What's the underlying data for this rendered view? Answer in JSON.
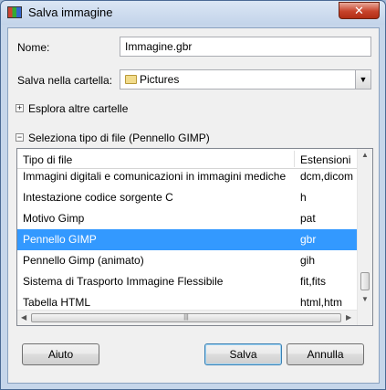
{
  "window": {
    "title": "Salva immagine",
    "close_label": "✕"
  },
  "form": {
    "name_label": "Nome:",
    "name_value": "Immagine.gbr",
    "folder_label": "Salva nella cartella:",
    "folder_value": "Pictures"
  },
  "expanders": {
    "browse_label": "Esplora altre cartelle",
    "browse_state": "+",
    "filetype_label": "Seleziona tipo di file (Pennello GIMP)",
    "filetype_state": "−"
  },
  "filetype_list": {
    "columns": [
      "Tipo di file",
      "Estensioni"
    ],
    "rows": [
      {
        "type": "Immagini digitali e comunicazioni in immagini mediche",
        "ext": "dcm,dicom"
      },
      {
        "type": "Intestazione codice sorgente C",
        "ext": "h"
      },
      {
        "type": "Motivo Gimp",
        "ext": "pat"
      },
      {
        "type": "Pennello GIMP",
        "ext": "gbr"
      },
      {
        "type": "Pennello Gimp (animato)",
        "ext": "gih"
      },
      {
        "type": "Sistema di Trasporto Immagine Flessibile",
        "ext": "fit,fits"
      },
      {
        "type": "Tabella HTML",
        "ext": "html,htm"
      }
    ],
    "selected_index": 3
  },
  "buttons": {
    "help": "Aiuto",
    "save": "Salva",
    "cancel": "Annulla"
  },
  "colors": {
    "selection": "#3399ff",
    "titlebar": "#c3d4ea",
    "close": "#c7432b"
  }
}
